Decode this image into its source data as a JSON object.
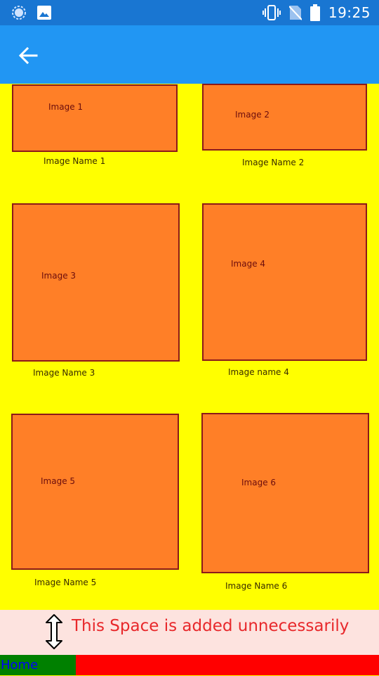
{
  "status_bar": {
    "time": "19:25",
    "icons": [
      "sync-icon",
      "image-icon",
      "vibrate-icon",
      "no-sim-icon",
      "battery-icon"
    ]
  },
  "app_bar": {
    "back_icon": "back-arrow-icon"
  },
  "grid": {
    "tiles": [
      {
        "image_label": "Image 1",
        "name": "Image Name 1"
      },
      {
        "image_label": "Image 2",
        "name": "Image Name 2"
      },
      {
        "image_label": "Image 3",
        "name": "Image Name 3"
      },
      {
        "image_label": "Image 4",
        "name": "Image name 4"
      },
      {
        "image_label": "Image 5",
        "name": "Image Name 5"
      },
      {
        "image_label": "Image 6",
        "name": "Image Name 6"
      }
    ]
  },
  "annotation": {
    "text": "This Space is added unnecessarily"
  },
  "tab_bar": {
    "home_label": "Home"
  },
  "colors": {
    "status_bar": "#1976d2",
    "app_bar": "#2196f3",
    "background": "#ffff00",
    "tile": "#ff7f27",
    "tile_border": "#8b1a1a",
    "annotation_bg": "#fde3df",
    "annotation_text": "#e8282b",
    "tab_home_bg": "#008000",
    "tab_home_text": "#0000ff",
    "tab_rest": "#ff0000"
  }
}
